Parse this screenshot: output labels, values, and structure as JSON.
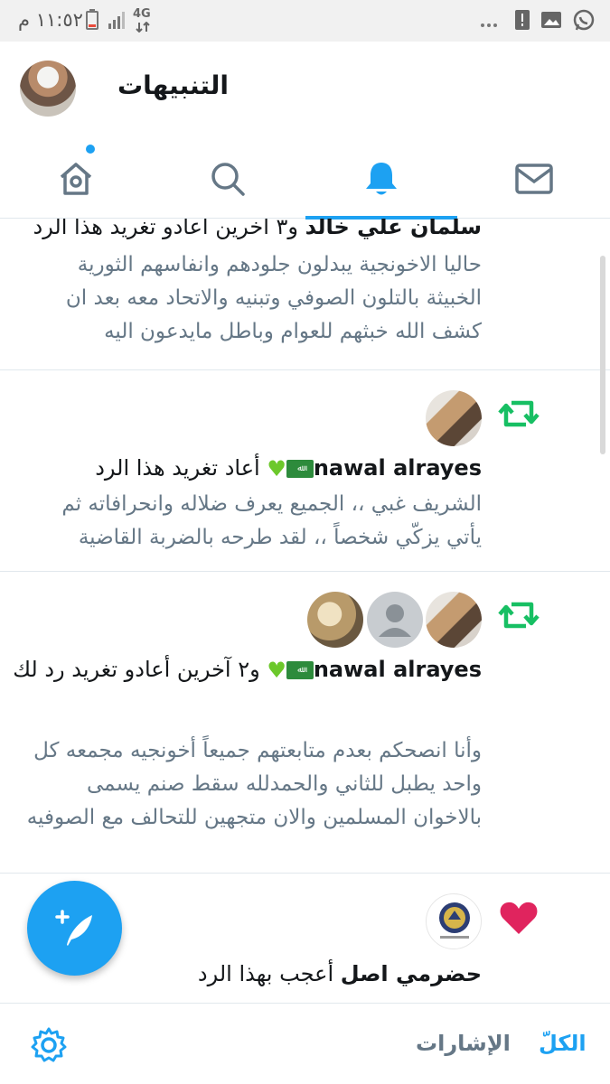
{
  "status_bar": {
    "time": "١١:٥٢ م",
    "network": "4G"
  },
  "header": {
    "title": "التنبيهات"
  },
  "tabs": [
    {
      "name": "home",
      "icon": "home-icon"
    },
    {
      "name": "search",
      "icon": "search-icon"
    },
    {
      "name": "notifications",
      "icon": "bell-icon",
      "active": true
    },
    {
      "name": "messages",
      "icon": "envelope-icon"
    }
  ],
  "notifications": [
    {
      "actor": "سلمان علي خالد",
      "action": " و٣ آخرين أعادو تغريد هذا الرد",
      "text": "حاليا الاخونجية يبدلون جلودهم وانفاسهم الثورية الخبيثة بالتلون الصوفي وتبنيه والاتحاد معه بعد ان كشف الله خبثهم للعوام وباطل مايدعون اليه"
    },
    {
      "type": "retweet",
      "actor": "nawal alrayes",
      "action": " أعاد تغريد هذا الرد",
      "text": "الشريف غبي ،، الجميع يعرف ضلاله وانحرافاته ثم يأتي يزكّي شخصاً ،، لقد طرحه بالضربة القاضية"
    },
    {
      "type": "retweet",
      "actor": "nawal alrayes",
      "action": " و٢ آخرين أعادو تغريد رد لك",
      "text": "وأنا انصحكم بعدم متابعتهم جميعاً أخونجيه مجمعه كل واحد يطبل للثاني والحمدلله سقط صنم يسمى بالاخوان المسلمين والان متجهين للتحالف مع الصوفيه"
    },
    {
      "type": "like",
      "actor": "حضرمي اصل",
      "action": " أعجب بهذا الرد",
      "avatar_caption": "مجلس الانتقالي الجنوبي"
    }
  ],
  "bottom_tabs": {
    "all": "الكلّ",
    "mentions": "الإشارات"
  },
  "colors": {
    "accent": "#1da1f2",
    "retweet": "#17bf63",
    "like": "#e0245e",
    "muted": "#657786"
  }
}
